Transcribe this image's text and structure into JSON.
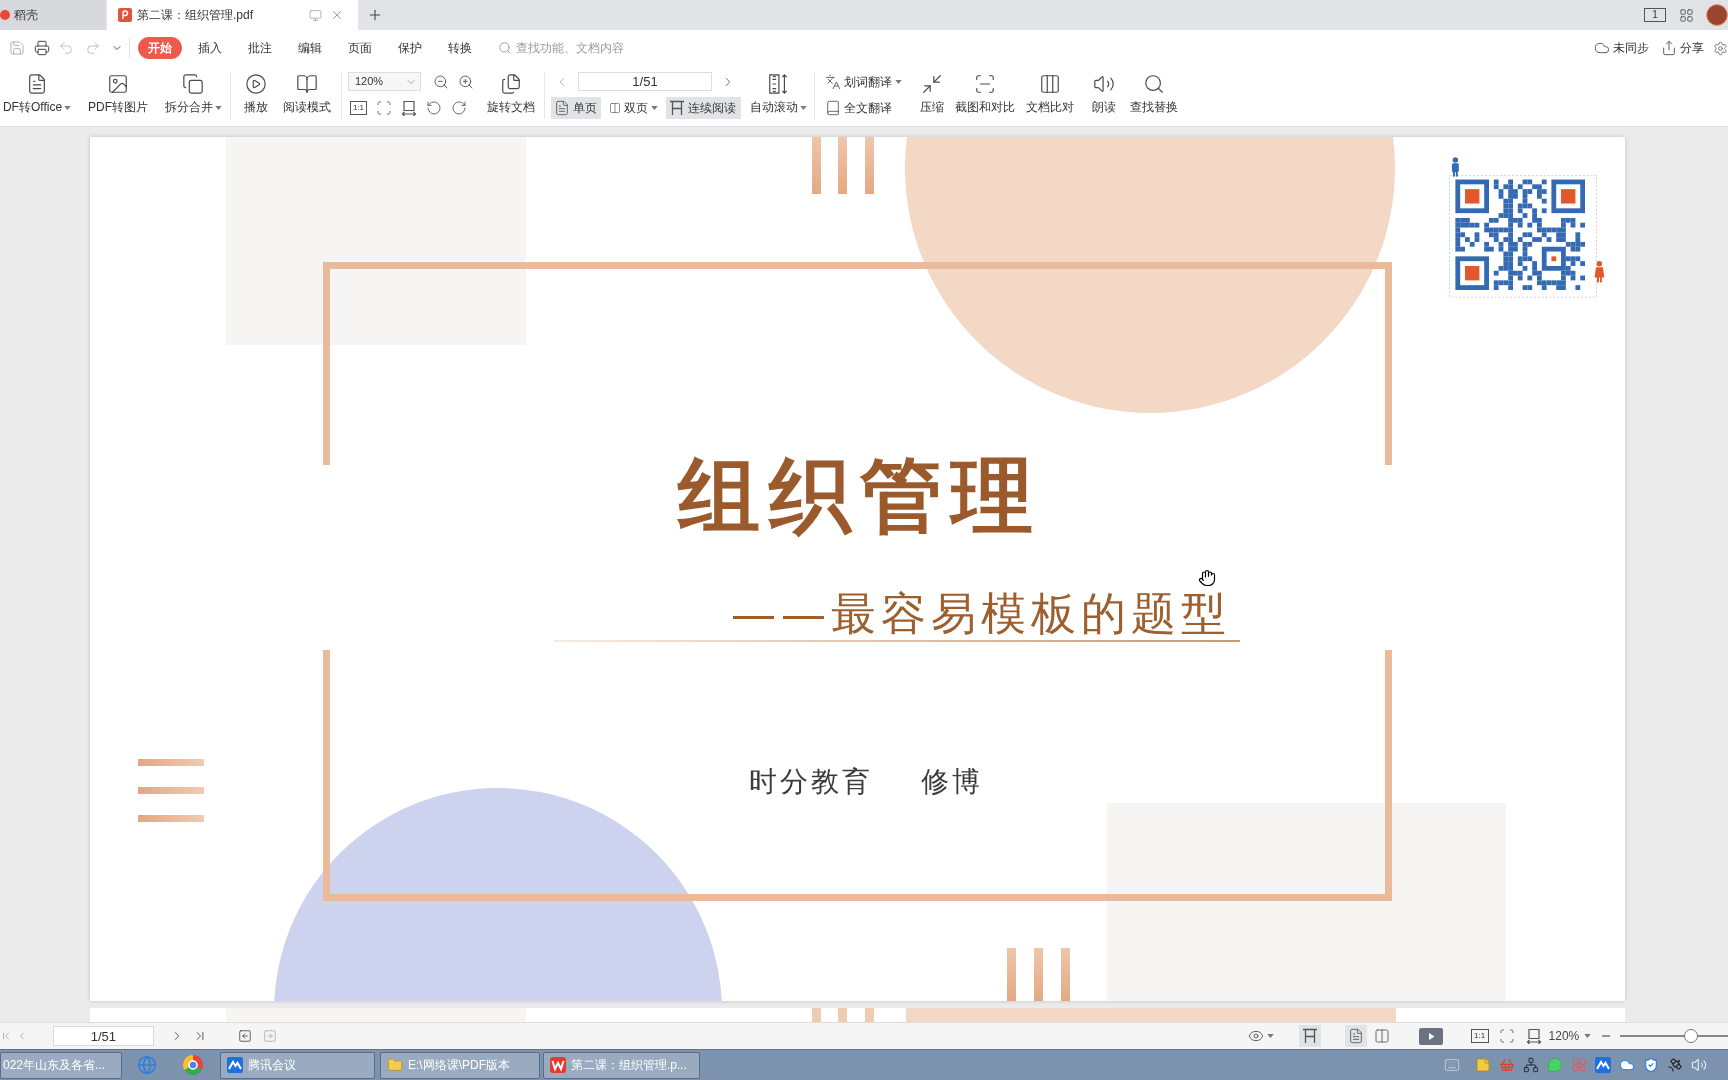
{
  "tab_bar": {
    "tabs": [
      {
        "label": "稻壳",
        "selected": false
      },
      {
        "label": "第二课：组织管理.pdf",
        "selected": true
      }
    ],
    "layout_toggle": "1"
  },
  "menu_bar": {
    "tabs": [
      {
        "label": "开始",
        "selected": true
      },
      {
        "label": "插入",
        "selected": false
      },
      {
        "label": "批注",
        "selected": false
      },
      {
        "label": "编辑",
        "selected": false
      },
      {
        "label": "页面",
        "selected": false
      },
      {
        "label": "保护",
        "selected": false
      },
      {
        "label": "转换",
        "selected": false
      }
    ],
    "search": {
      "placeholder": "查找功能、文档内容"
    },
    "actions": [
      {
        "label": "未同步"
      },
      {
        "label": "分享"
      }
    ]
  },
  "ribbon": {
    "convert": [
      {
        "label": "DF转Office",
        "dropdown": true
      },
      {
        "label": "PDF转图片",
        "dropdown": false
      },
      {
        "label": "拆分合并",
        "dropdown": true
      }
    ],
    "view": [
      {
        "label": "播放",
        "dropdown": false
      },
      {
        "label": "阅读模式",
        "dropdown": false
      }
    ],
    "zoom": {
      "value": "120%",
      "actual_size": "1:1"
    },
    "rotate": {
      "label": "旋转文档",
      "dropdown": false
    },
    "page_field": {
      "value": "1/51"
    },
    "layouts": [
      {
        "label": "单页",
        "selected": true,
        "dropdown": false
      },
      {
        "label": "双页",
        "selected": false,
        "dropdown": true
      },
      {
        "label": "连续阅读",
        "selected": true,
        "dropdown": false
      }
    ],
    "auto_scroll": {
      "label": "自动滚动",
      "dropdown": true
    },
    "translate": [
      {
        "label": "划词翻译",
        "dropdown": true
      },
      {
        "label": "全文翻译",
        "dropdown": false
      }
    ],
    "tools": [
      {
        "label": "压缩",
        "dropdown": false
      },
      {
        "label": "截图和对比",
        "dropdown": false
      },
      {
        "label": "文档比对",
        "dropdown": false
      },
      {
        "label": "朗读",
        "dropdown": false
      },
      {
        "label": "查找替换",
        "dropdown": false
      }
    ]
  },
  "document": {
    "slide": {
      "title": "组织管理",
      "subtitle": "——最容易模板的题型",
      "organization": "时分教育",
      "author": "修博"
    }
  },
  "status_bar": {
    "page_field": "1/51",
    "views": [
      {
        "selected": true
      },
      {
        "selected": true
      },
      {
        "selected": false
      }
    ],
    "actual_size": "1:1",
    "zoom": "120%",
    "zoom_slider": {
      "level": 0.66
    }
  },
  "taskbar": {
    "windows": [
      {
        "label": "022年山东及各省..."
      },
      {
        "label": "腾讯会议"
      },
      {
        "label": "E:\\网络课\\PDF版本"
      },
      {
        "label": "第二课：组织管理.p..."
      }
    ]
  }
}
